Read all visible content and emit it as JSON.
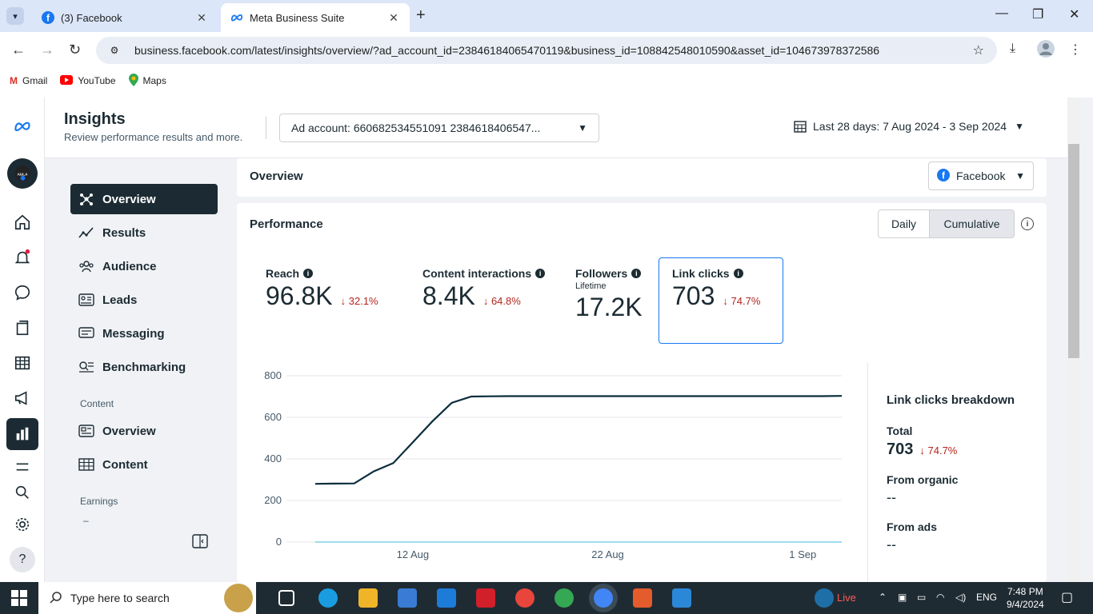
{
  "browser": {
    "tabs": [
      {
        "label": "(3) Facebook",
        "active": false
      },
      {
        "label": "Meta Business Suite",
        "active": true
      }
    ],
    "url": "business.facebook.com/latest/insights/overview/?ad_account_id=23846184065470119&business_id=108842548010590&asset_id=104673978372586",
    "bookmarks": [
      {
        "label": "Gmail",
        "icon": "gmail-icon"
      },
      {
        "label": "YouTube",
        "icon": "youtube-icon"
      },
      {
        "label": "Maps",
        "icon": "maps-icon"
      }
    ]
  },
  "header": {
    "title": "Insights",
    "subtitle": "Review performance results and more.",
    "account_select": "Ad account: 660682534551091 2384618406547...",
    "date_range": "Last 28 days: 7 Aug 2024 - 3 Sep 2024"
  },
  "leftnav": {
    "items": [
      {
        "label": "Overview",
        "icon": "overview-icon",
        "active": true
      },
      {
        "label": "Results",
        "icon": "results-icon"
      },
      {
        "label": "Audience",
        "icon": "audience-icon"
      },
      {
        "label": "Leads",
        "icon": "leads-icon"
      },
      {
        "label": "Messaging",
        "icon": "messaging-icon"
      },
      {
        "label": "Benchmarking",
        "icon": "benchmarking-icon"
      }
    ],
    "content_section": "Content",
    "content_items": [
      {
        "label": "Overview",
        "icon": "content-overview-icon"
      },
      {
        "label": "Content",
        "icon": "content-table-icon"
      }
    ],
    "earnings_section": "Earnings",
    "earnings_sub": "–"
  },
  "overview": {
    "title": "Overview",
    "platform_select": "Facebook"
  },
  "performance": {
    "title": "Performance",
    "toggle_daily": "Daily",
    "toggle_cumulative": "Cumulative",
    "metrics": [
      {
        "label": "Reach",
        "value": "96.8K",
        "change": "32.1%"
      },
      {
        "label": "Content interactions",
        "value": "8.4K",
        "change": "64.8%"
      },
      {
        "label": "Followers",
        "sub": "Lifetime",
        "value": "17.2K"
      },
      {
        "label": "Link clicks",
        "value": "703",
        "change": "74.7%",
        "selected": true
      }
    ]
  },
  "breakdown": {
    "title": "Link clicks breakdown",
    "total_label": "Total",
    "total_value": "703",
    "total_change": "74.7%",
    "organic_label": "From organic",
    "organic_value": "--",
    "ads_label": "From ads",
    "ads_value": "--"
  },
  "chart_data": {
    "type": "line",
    "title": "",
    "xlabel": "",
    "ylabel": "",
    "ylim": [
      0,
      800
    ],
    "yticks": [
      0,
      200,
      400,
      600,
      800
    ],
    "xticks": [
      "12 Aug",
      "22 Aug",
      "1 Sep"
    ],
    "x": [
      "7 Aug",
      "8 Aug",
      "9 Aug",
      "10 Aug",
      "11 Aug",
      "12 Aug",
      "13 Aug",
      "14 Aug",
      "15 Aug",
      "16 Aug",
      "17 Aug",
      "18 Aug",
      "19 Aug",
      "20 Aug",
      "21 Aug",
      "22 Aug",
      "23 Aug",
      "24 Aug",
      "25 Aug",
      "26 Aug",
      "27 Aug",
      "28 Aug",
      "29 Aug",
      "30 Aug",
      "31 Aug",
      "1 Sep",
      "2 Sep",
      "3 Sep"
    ],
    "series": [
      {
        "color": "#0a2d3c",
        "values": [
          280,
          281,
          282,
          340,
          380,
          480,
          580,
          670,
          700,
          701,
          702,
          702,
          702,
          702,
          702,
          702,
          702,
          702,
          702,
          702,
          702,
          702,
          702,
          702,
          702,
          702,
          702,
          703
        ]
      },
      {
        "color": "#7cd0e6",
        "values": [
          0,
          0,
          0,
          0,
          0,
          0,
          0,
          0,
          0,
          0,
          0,
          0,
          0,
          0,
          0,
          0,
          0,
          0,
          0,
          0,
          0,
          0,
          0,
          0,
          0,
          0,
          0,
          0
        ]
      }
    ],
    "grid": true
  },
  "taskbar": {
    "search_placeholder": "Type here to search",
    "live_label": "Live",
    "lang": "ENG",
    "time": "7:48 PM",
    "date": "9/4/2024"
  },
  "colors": {
    "accent": "#1877f2",
    "dark": "#1c2b33",
    "negative": "#b3261e"
  }
}
